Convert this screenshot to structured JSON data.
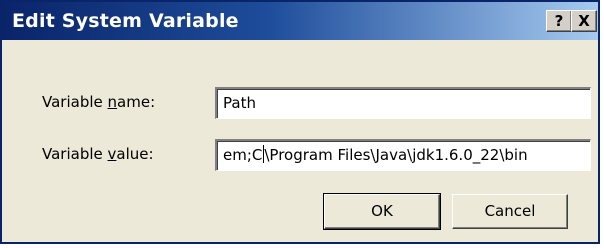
{
  "window": {
    "title": "Edit System Variable",
    "help_button": "?",
    "close_button": "X"
  },
  "form": {
    "name_label_pre": "Variable ",
    "name_label_accel": "n",
    "name_label_post": "ame:",
    "name_value": "Path",
    "value_label_pre": "Variable ",
    "value_label_accel": "v",
    "value_label_post": "alue:",
    "value_before_caret": "em;C",
    "value_after_caret": "\\Program Files\\Java\\jdk1.6.0_22\\bin"
  },
  "buttons": {
    "ok_label": "OK",
    "cancel_label": "Cancel"
  }
}
